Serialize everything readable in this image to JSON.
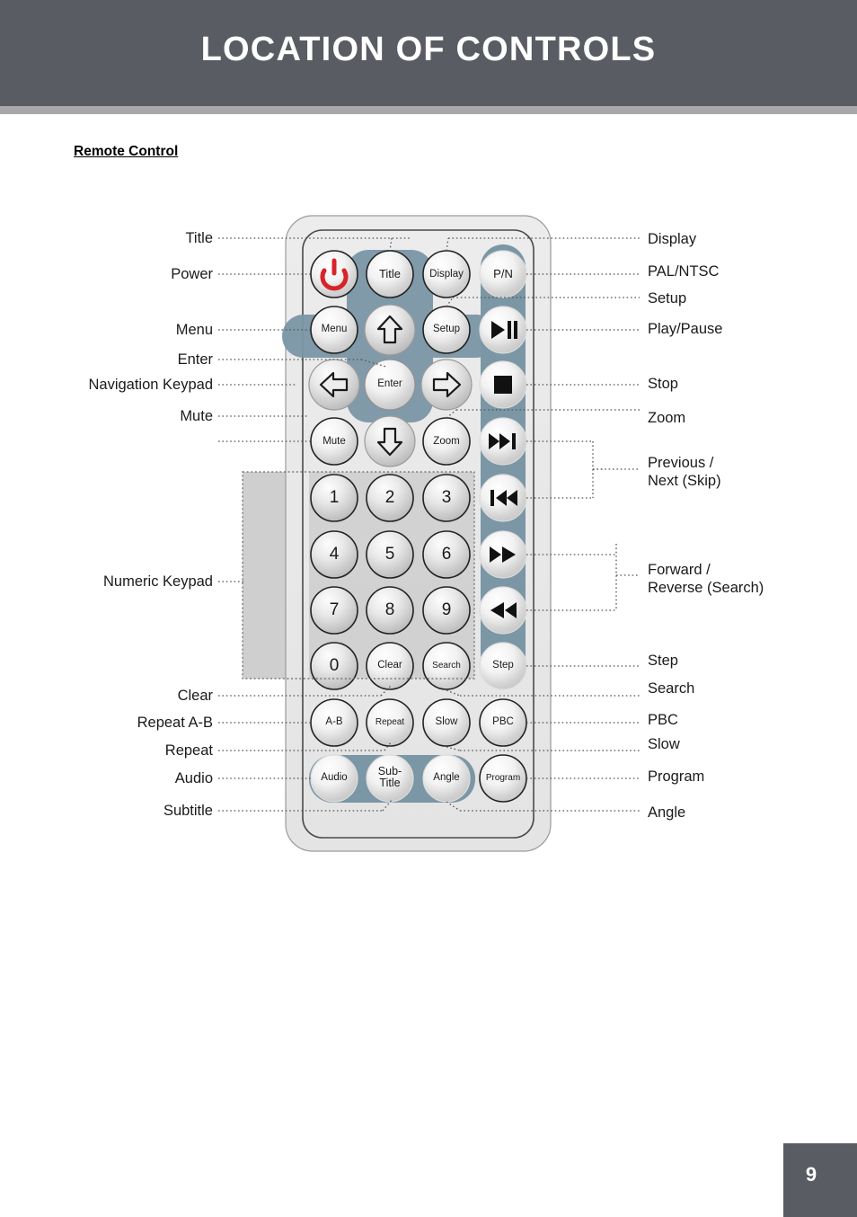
{
  "header": {
    "title": "LOCATION OF CONTROLS"
  },
  "section": {
    "heading": "Remote Control"
  },
  "page": {
    "number": "9"
  },
  "colors": {
    "header_bg": "#595c62",
    "header_rule": "#a8a8aa",
    "remote_body": "#e8e8e8",
    "accent_blue": "#7b96a5",
    "keypad_highlight": "#cfcfcf",
    "power_icon_red": "#d8232a",
    "text": "#1a1a1a"
  },
  "left_labels": [
    {
      "id": "title",
      "text": "Title"
    },
    {
      "id": "power",
      "text": "Power"
    },
    {
      "id": "menu",
      "text": "Menu"
    },
    {
      "id": "enter",
      "text": "Enter"
    },
    {
      "id": "navigation-keypad",
      "text": "Navigation Keypad"
    },
    {
      "id": "mute",
      "text": "Mute"
    },
    {
      "id": "numeric-keypad",
      "text": "Numeric Keypad"
    },
    {
      "id": "clear",
      "text": "Clear"
    },
    {
      "id": "repeat-a-b",
      "text": "Repeat A-B"
    },
    {
      "id": "repeat",
      "text": "Repeat"
    },
    {
      "id": "audio",
      "text": "Audio"
    },
    {
      "id": "subtitle",
      "text": "Subtitle"
    }
  ],
  "right_labels": [
    {
      "id": "display",
      "text": "Display"
    },
    {
      "id": "pal-ntsc",
      "text": "PAL/NTSC"
    },
    {
      "id": "setup",
      "text": "Setup"
    },
    {
      "id": "play-pause",
      "text": "Play/Pause"
    },
    {
      "id": "stop",
      "text": "Stop"
    },
    {
      "id": "zoom",
      "text": "Zoom"
    },
    {
      "id": "previous-next",
      "text": "Previous /\nNext (Skip)",
      "line1": "Previous /",
      "line2": "Next (Skip)"
    },
    {
      "id": "forward-reverse",
      "text": "Forward /\nReverse (Search)",
      "line1": "Forward /",
      "line2": "Reverse (Search)"
    },
    {
      "id": "step",
      "text": "Step"
    },
    {
      "id": "search",
      "text": "Search"
    },
    {
      "id": "pbc",
      "text": "PBC"
    },
    {
      "id": "slow",
      "text": "Slow"
    },
    {
      "id": "program",
      "text": "Program"
    },
    {
      "id": "angle",
      "text": "Angle"
    }
  ],
  "remote_buttons": [
    {
      "id": "power",
      "label": "",
      "icon": "power-icon"
    },
    {
      "id": "title",
      "label": "Title",
      "icon": ""
    },
    {
      "id": "display",
      "label": "Display",
      "icon": ""
    },
    {
      "id": "pn",
      "label": "P/N",
      "icon": ""
    },
    {
      "id": "menu",
      "label": "Menu",
      "icon": ""
    },
    {
      "id": "up",
      "label": "",
      "icon": "arrow-up-icon"
    },
    {
      "id": "setup",
      "label": "Setup",
      "icon": ""
    },
    {
      "id": "playpause",
      "label": "",
      "icon": "play-pause-icon"
    },
    {
      "id": "left",
      "label": "",
      "icon": "arrow-left-icon"
    },
    {
      "id": "enter",
      "label": "Enter",
      "icon": ""
    },
    {
      "id": "right",
      "label": "",
      "icon": "arrow-right-icon"
    },
    {
      "id": "stop",
      "label": "",
      "icon": "stop-icon"
    },
    {
      "id": "mute",
      "label": "Mute",
      "icon": ""
    },
    {
      "id": "down",
      "label": "",
      "icon": "arrow-down-icon"
    },
    {
      "id": "zoom",
      "label": "Zoom",
      "icon": ""
    },
    {
      "id": "next",
      "label": "",
      "icon": "skip-next-icon"
    },
    {
      "id": "num1",
      "label": "1",
      "icon": ""
    },
    {
      "id": "num2",
      "label": "2",
      "icon": ""
    },
    {
      "id": "num3",
      "label": "3",
      "icon": ""
    },
    {
      "id": "prev",
      "label": "",
      "icon": "skip-previous-icon"
    },
    {
      "id": "num4",
      "label": "4",
      "icon": ""
    },
    {
      "id": "num5",
      "label": "5",
      "icon": ""
    },
    {
      "id": "num6",
      "label": "6",
      "icon": ""
    },
    {
      "id": "forward",
      "label": "",
      "icon": "fast-forward-icon"
    },
    {
      "id": "num7",
      "label": "7",
      "icon": ""
    },
    {
      "id": "num8",
      "label": "8",
      "icon": ""
    },
    {
      "id": "num9",
      "label": "9",
      "icon": ""
    },
    {
      "id": "reverse",
      "label": "",
      "icon": "rewind-icon"
    },
    {
      "id": "num0",
      "label": "0",
      "icon": ""
    },
    {
      "id": "clear",
      "label": "Clear",
      "icon": ""
    },
    {
      "id": "search",
      "label": "Search",
      "icon": ""
    },
    {
      "id": "step",
      "label": "Step",
      "icon": ""
    },
    {
      "id": "ab",
      "label": "A-B",
      "icon": ""
    },
    {
      "id": "repeat",
      "label": "Repeat",
      "icon": ""
    },
    {
      "id": "slow",
      "label": "Slow",
      "icon": ""
    },
    {
      "id": "pbc",
      "label": "PBC",
      "icon": ""
    },
    {
      "id": "audio",
      "label": "Audio",
      "icon": ""
    },
    {
      "id": "subtitle",
      "label": "Sub-Title",
      "line1": "Sub-",
      "line2": "Title",
      "icon": ""
    },
    {
      "id": "angle",
      "label": "Angle",
      "icon": ""
    },
    {
      "id": "program",
      "label": "Program",
      "icon": ""
    }
  ]
}
